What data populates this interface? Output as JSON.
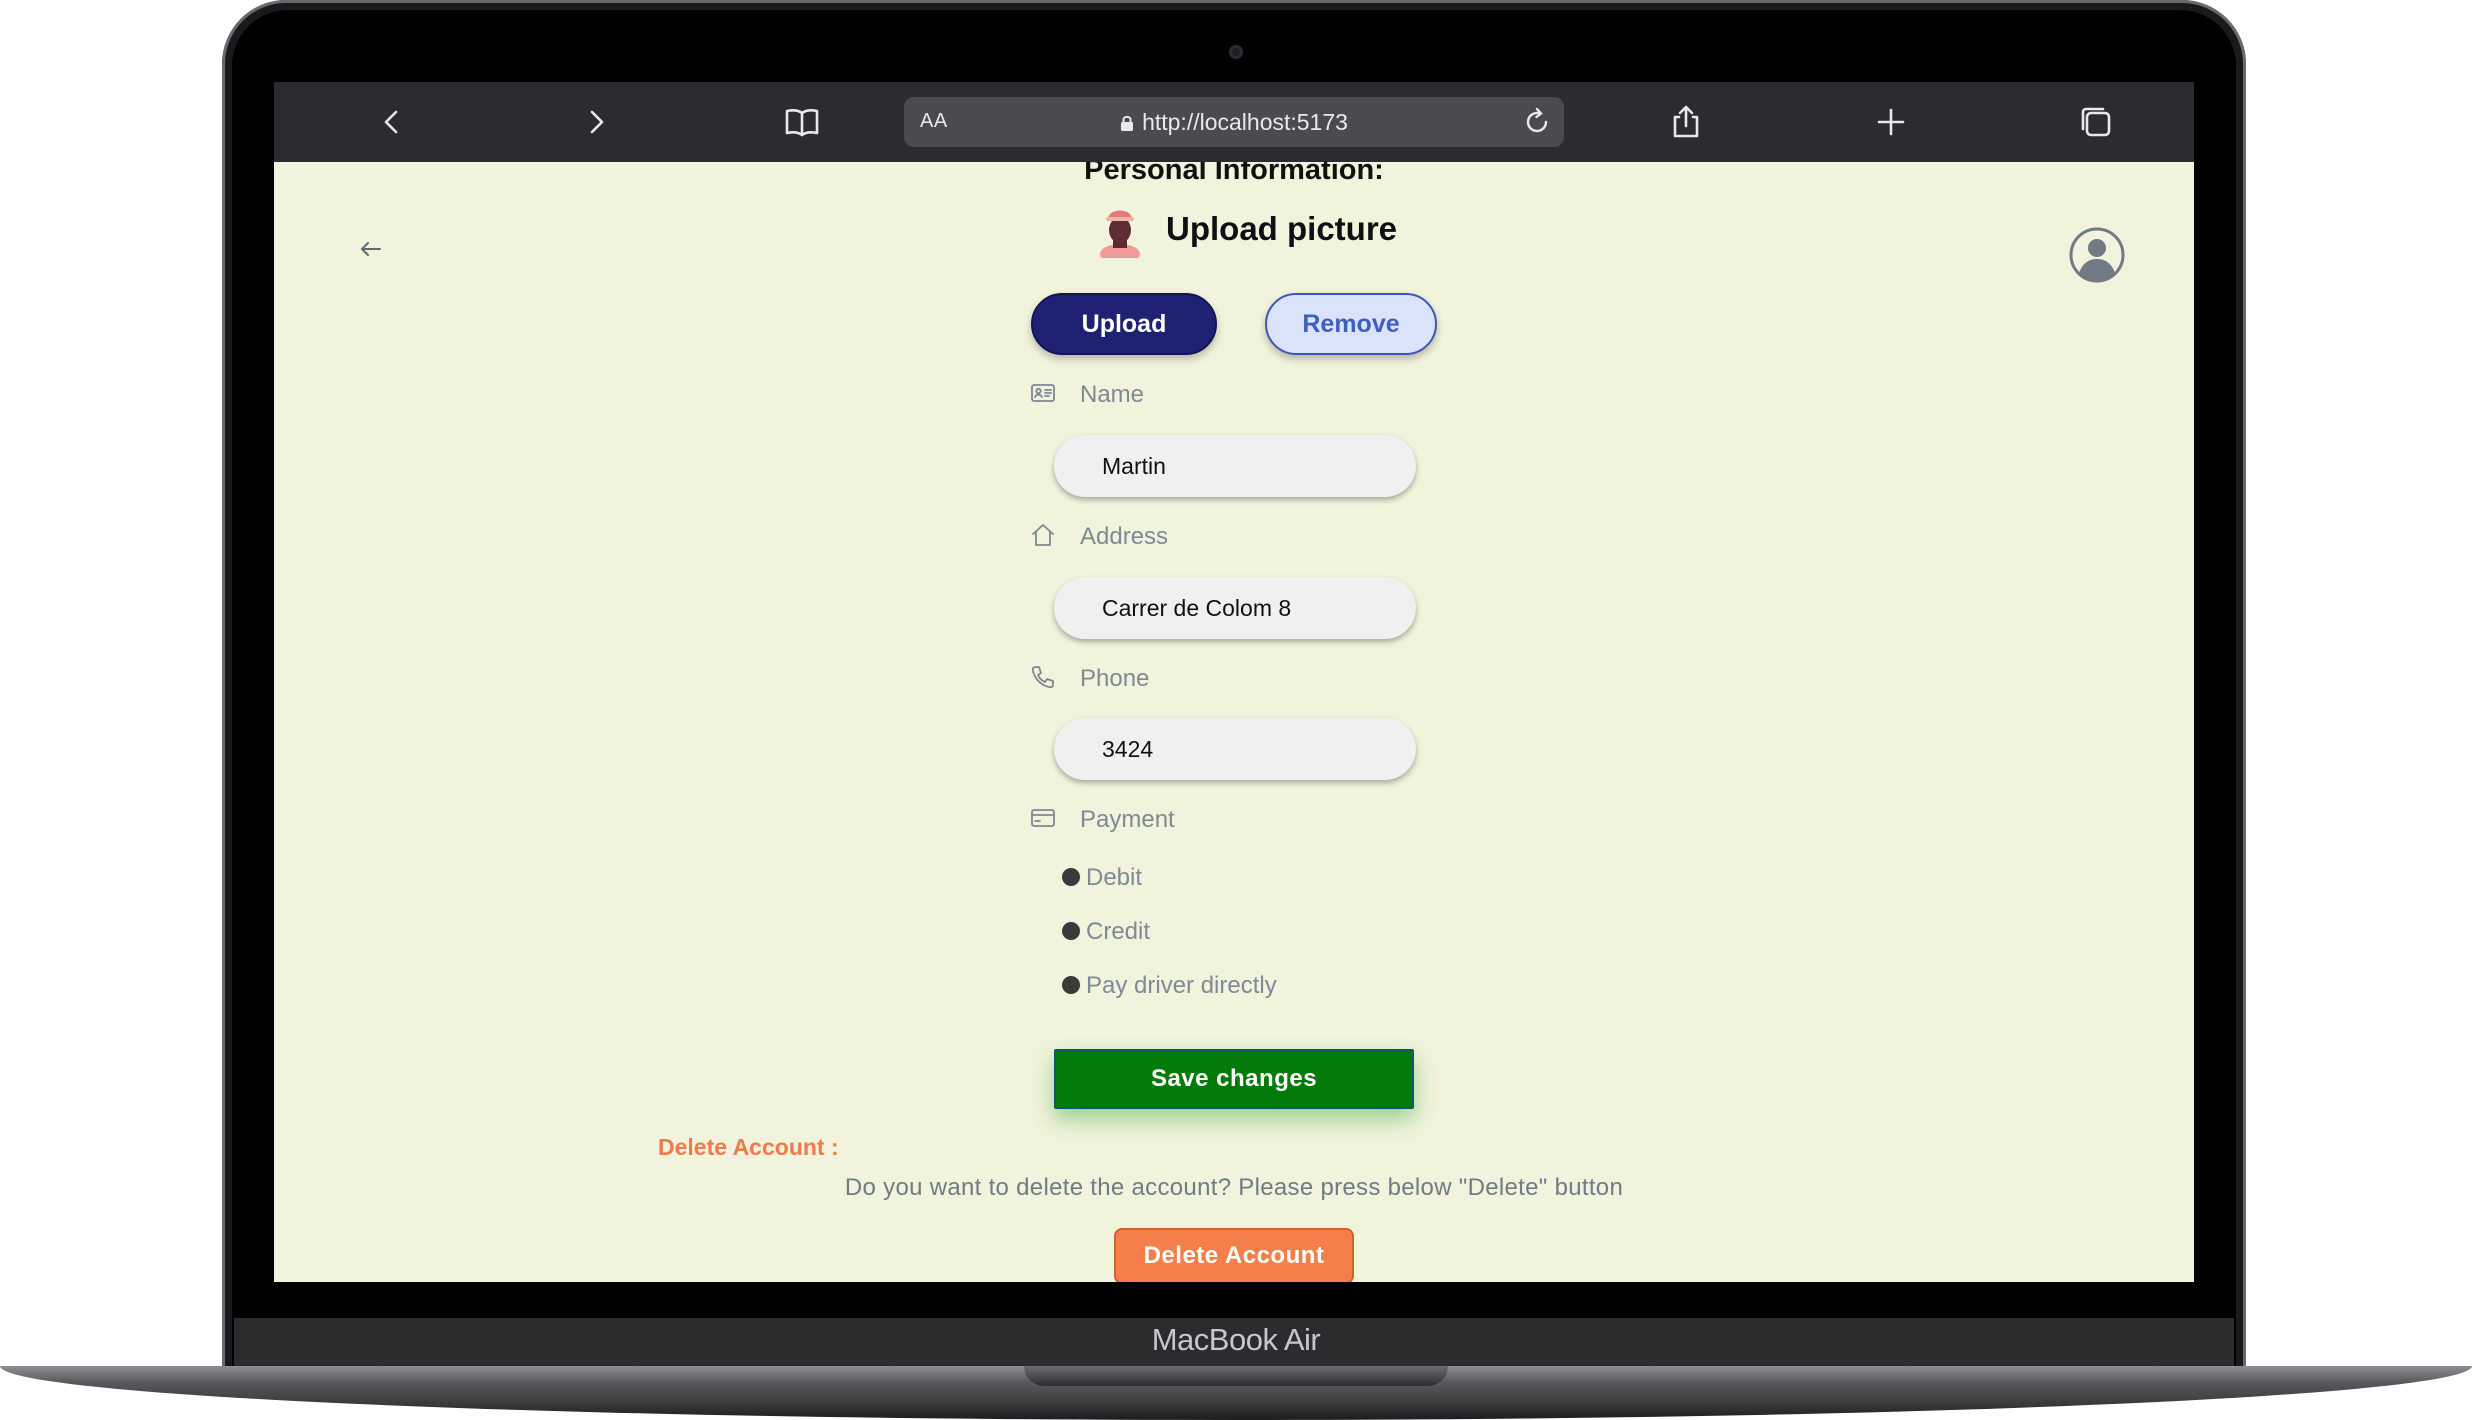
{
  "device": {
    "brand_label": "MacBook Air"
  },
  "browser": {
    "text_size_label": "AA",
    "url": "http://localhost:5173",
    "icons": [
      "chevron-left-icon",
      "chevron-right-icon",
      "book-icon",
      "lock-icon",
      "reload-icon",
      "share-icon",
      "plus-icon",
      "tabs-icon"
    ]
  },
  "page": {
    "title": "Personal Information:",
    "upload_title": "Upload picture",
    "upload_label": "Upload",
    "remove_label": "Remove",
    "fields": {
      "name": {
        "label": "Name",
        "value": "Martin",
        "icon": "id-card-icon"
      },
      "address": {
        "label": "Address",
        "value": "Carrer de Colom 8",
        "icon": "home-icon"
      },
      "phone": {
        "label": "Phone",
        "value": "3424",
        "icon": "phone-icon"
      }
    },
    "payment": {
      "label": "Payment",
      "icon": "credit-card-icon",
      "options": [
        "Debit",
        "Credit",
        "Pay driver directly"
      ]
    },
    "save_label": "Save changes",
    "delete_heading": "Delete Account :",
    "delete_message": "Do you want to delete the account? Please press below \"Delete\" button",
    "delete_label": "Delete Account"
  },
  "colors": {
    "page_bg": "#f1f3dc",
    "upload_button": "#1f2272",
    "remove_button": "#dbe3fb",
    "save_button": "#047a0b",
    "delete_button": "#f57f4b",
    "delete_heading": "#f07a4a"
  }
}
